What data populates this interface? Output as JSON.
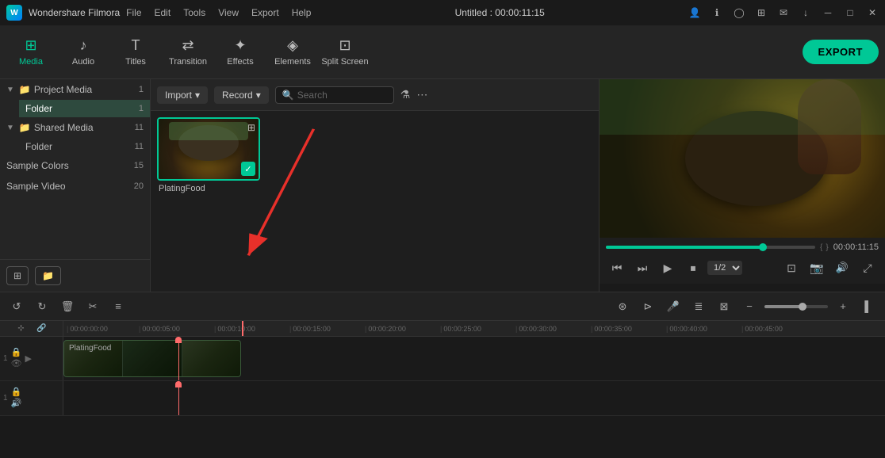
{
  "app": {
    "name": "Wondershare Filmora",
    "logo": "W",
    "title": "Untitled : 00:00:11:15"
  },
  "menus": [
    "File",
    "Edit",
    "Tools",
    "View",
    "Export",
    "Help"
  ],
  "titlebar_icons": [
    "account",
    "info",
    "person",
    "grid",
    "mail",
    "download",
    "minimize",
    "maximize",
    "close"
  ],
  "toolbar": {
    "items": [
      {
        "id": "media",
        "label": "Media",
        "icon": "⊞",
        "active": true
      },
      {
        "id": "audio",
        "label": "Audio",
        "icon": "♪"
      },
      {
        "id": "titles",
        "label": "Titles",
        "icon": "T"
      },
      {
        "id": "transition",
        "label": "Transition",
        "icon": "⇄"
      },
      {
        "id": "effects",
        "label": "Effects",
        "icon": "✦"
      },
      {
        "id": "elements",
        "label": "Elements",
        "icon": "◈"
      },
      {
        "id": "splitscreen",
        "label": "Split Screen",
        "icon": "⊡"
      }
    ],
    "export_label": "EXPORT"
  },
  "sidebar": {
    "sections": [
      {
        "id": "project-media",
        "label": "Project Media",
        "count": "1",
        "expanded": true,
        "children": [
          {
            "id": "folder-project",
            "label": "Folder",
            "count": "1"
          }
        ]
      },
      {
        "id": "shared-media",
        "label": "Shared Media",
        "count": "11",
        "expanded": true,
        "children": [
          {
            "id": "folder-shared",
            "label": "Folder",
            "count": "11"
          }
        ]
      },
      {
        "id": "sample-colors",
        "label": "Sample Colors",
        "count": "15"
      },
      {
        "id": "sample-video",
        "label": "Sample Video",
        "count": "20"
      }
    ],
    "actions": [
      {
        "id": "new-folder",
        "icon": "+"
      },
      {
        "id": "import-folder",
        "icon": "📁"
      }
    ]
  },
  "center": {
    "import_label": "Import",
    "record_label": "Record",
    "search_placeholder": "Search",
    "media_items": [
      {
        "id": "plating-food",
        "label": "PlatingFood",
        "selected": true
      }
    ]
  },
  "preview": {
    "timestamp": "00:00:11:15",
    "speed": "1/2"
  },
  "timeline": {
    "timestamps": [
      "00:00:00:00",
      "00:00:05:00",
      "00:00:10:00",
      "00:00:15:00",
      "00:00:20:00",
      "00:00:25:00",
      "00:00:30:00",
      "00:00:35:00",
      "00:00:40:00",
      "00:00:45:00"
    ],
    "tracks": [
      {
        "id": "video1",
        "num": "1",
        "type": "video",
        "clip_label": "PlatingFood"
      },
      {
        "id": "audio1",
        "num": "1",
        "type": "audio"
      }
    ]
  }
}
